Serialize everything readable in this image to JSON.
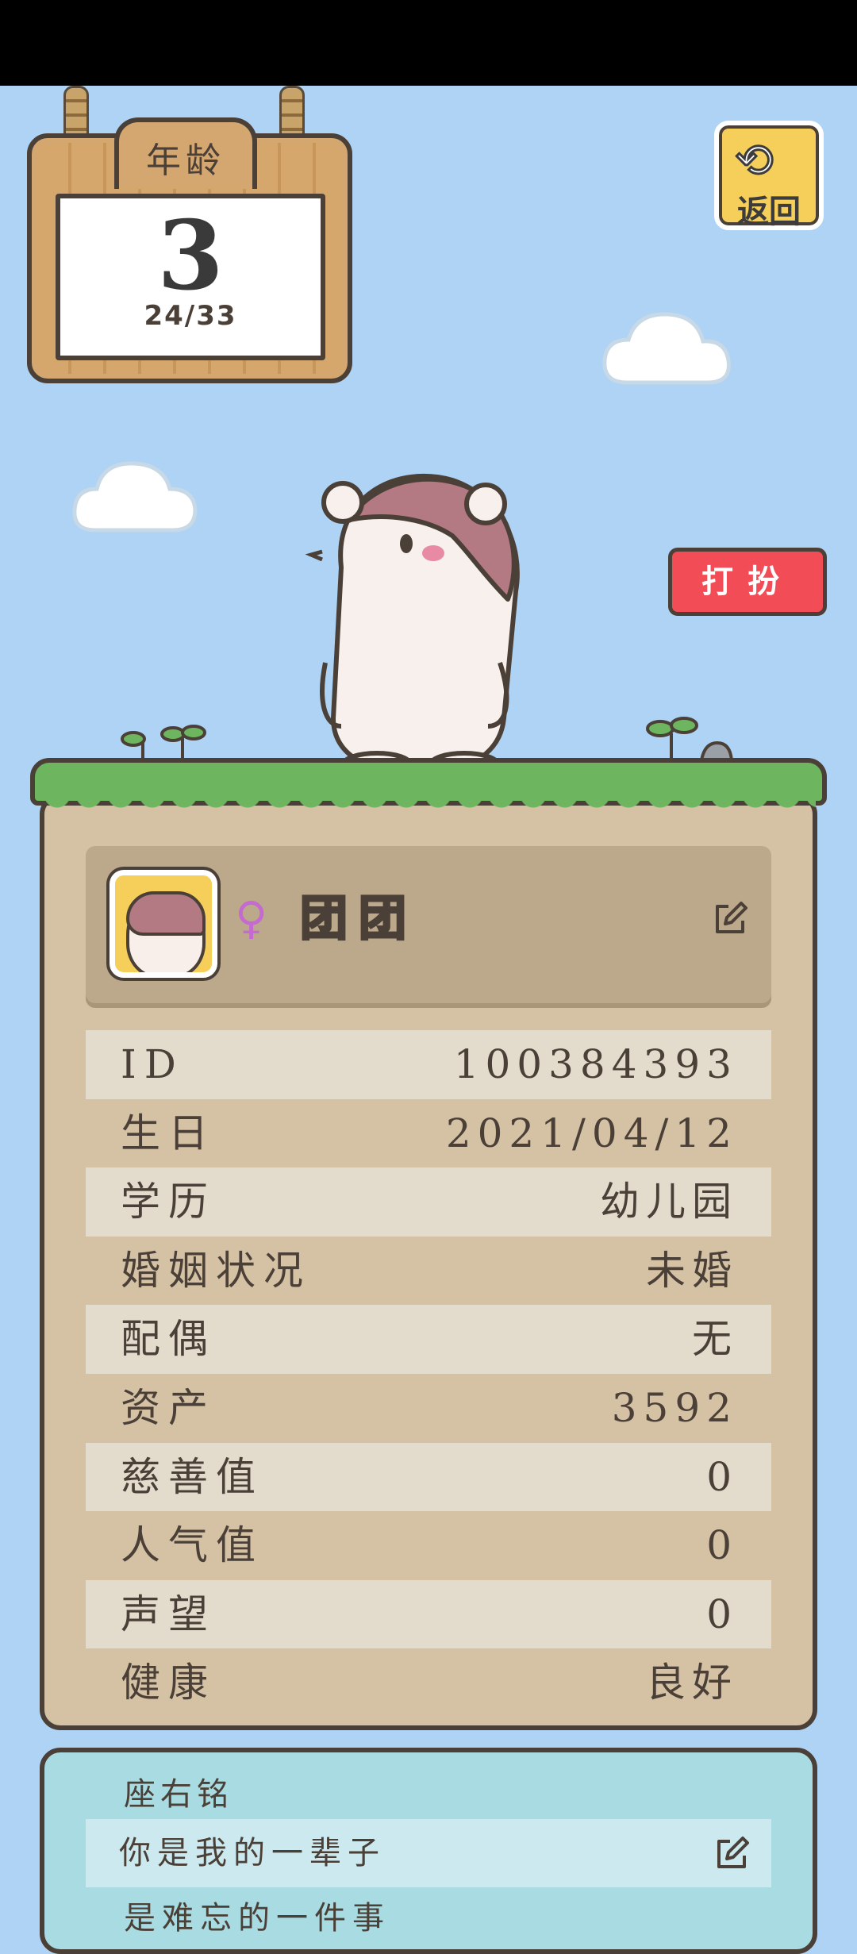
{
  "age_sign": {
    "title": "年龄",
    "age": "3",
    "progress": "24/33"
  },
  "back_button": {
    "label": "返回",
    "icon": "back-arrow-icon"
  },
  "dress_button": {
    "label": "打扮"
  },
  "profile": {
    "gender_symbol": "♀",
    "gender_color": "#c46ad0",
    "name": "团团",
    "edit_icon": "pencil-edit-icon"
  },
  "info_rows": [
    {
      "key": "ID",
      "value": "100384393"
    },
    {
      "key": "生日",
      "value": "2021/04/12"
    },
    {
      "key": "学历",
      "value": "幼儿园"
    },
    {
      "key": "婚姻状况",
      "value": "未婚"
    },
    {
      "key": "配偶",
      "value": "无"
    },
    {
      "key": "资产",
      "value": "3592"
    },
    {
      "key": "慈善值",
      "value": "0"
    },
    {
      "key": "人气值",
      "value": "0"
    },
    {
      "key": "声望",
      "value": "0"
    },
    {
      "key": "健康",
      "value": "良好"
    }
  ],
  "motto": {
    "title": "座右铭",
    "line1": "你是我的一辈子",
    "line2": "是难忘的一件事"
  },
  "colors": {
    "sky": "#aed3f4",
    "card": "#d5c2a5",
    "motto_card": "#a8dbe2",
    "accent_red": "#f24c56",
    "accent_yellow": "#f6cf5a",
    "grass": "#6db65f"
  }
}
